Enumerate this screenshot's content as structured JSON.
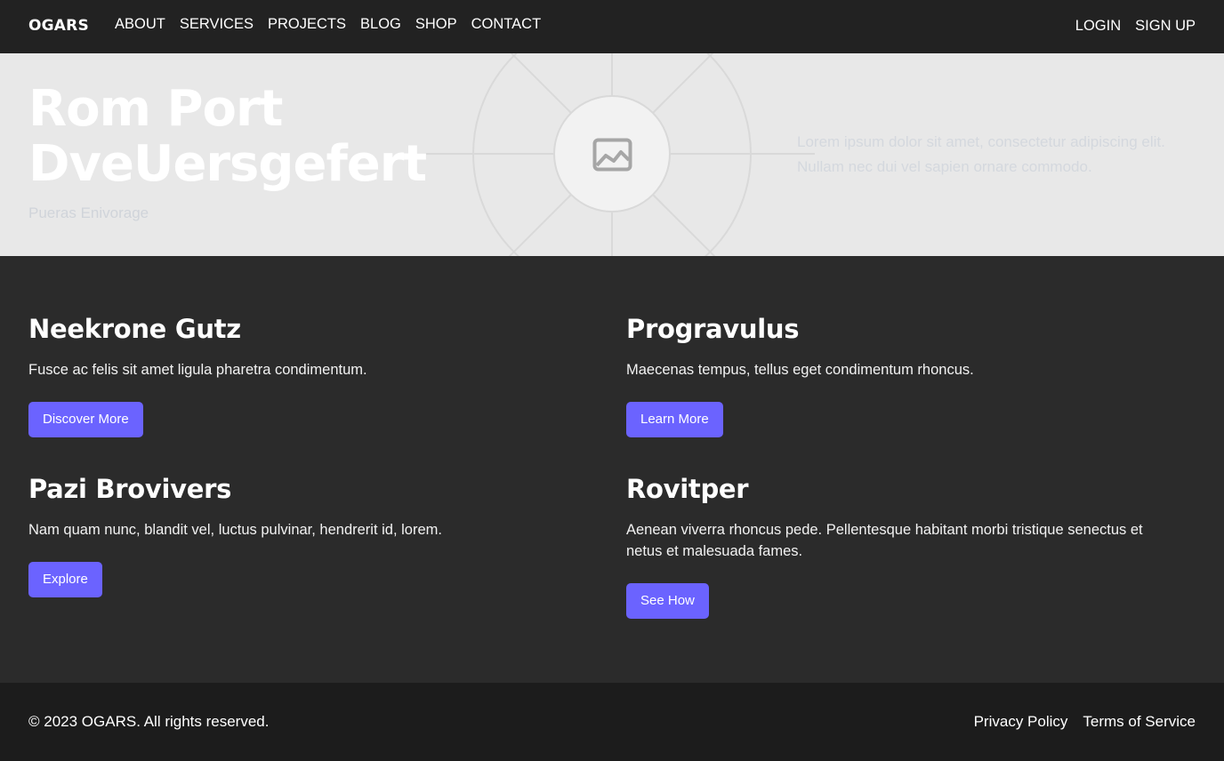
{
  "nav": {
    "brand": "OGARS",
    "links": [
      "ABOUT",
      "SERVICES",
      "PROJECTS",
      "BLOG",
      "SHOP",
      "CONTACT"
    ],
    "auth": {
      "login": "LOGIN",
      "signup": "SIGN UP"
    }
  },
  "hero": {
    "title_line1": "Rom Port",
    "title_line2": "DveUersgefert",
    "subtitle": "Pueras Enivorage",
    "description": "Lorem ipsum dolor sit amet, consectetur adipiscing elit. Nullam nec dui vel sapien ornare commodo.",
    "image_icon": "image-placeholder-icon"
  },
  "cards": [
    {
      "title": "Neekrone Gutz",
      "text": "Fusce ac felis sit amet ligula pharetra condimentum.",
      "button": "Discover More"
    },
    {
      "title": "Progravulus",
      "text": "Maecenas tempus, tellus eget condimentum rhoncus.",
      "button": "Learn More"
    },
    {
      "title": "Pazi Brovivers",
      "text": "Nam quam nunc, blandit vel, luctus pulvinar, hendrerit id, lorem.",
      "button": "Explore"
    },
    {
      "title": "Rovitper",
      "text": "Aenean viverra rhoncus pede. Pellentesque habitant morbi tristique senectus et netus et malesuada fames.",
      "button": "See How"
    }
  ],
  "footer": {
    "copyright": "© 2023 OGARS. All rights reserved.",
    "links": [
      "Privacy Policy",
      "Terms of Service"
    ]
  },
  "colors": {
    "nav_bg": "#222222",
    "hero_bg": "#e8e8e8",
    "main_bg": "#2b2b2b",
    "footer_bg": "#1c1c1c",
    "accent": "#6b63ff"
  }
}
